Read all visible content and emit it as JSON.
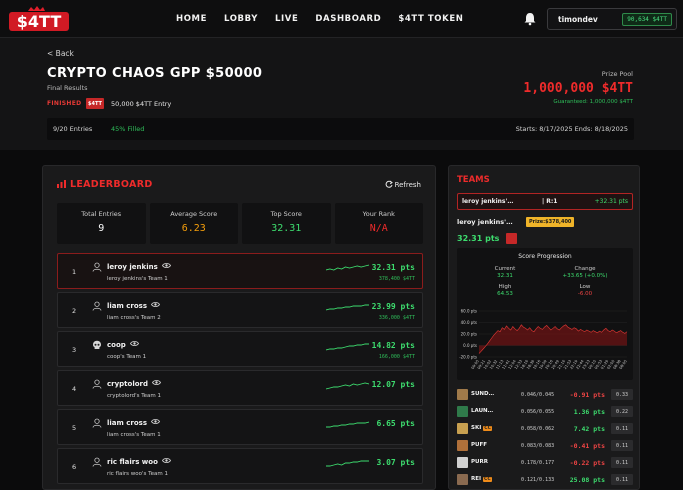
{
  "nav": {
    "logo_text": "$4TT",
    "links": [
      "HOME",
      "LOBBY",
      "LIVE",
      "DASHBOARD",
      "$4TT TOKEN"
    ],
    "username": "timondev",
    "balance": "90,634 $4TT"
  },
  "contest": {
    "back_label": "< Back",
    "title": "CRYPTO CHAOS GPP $50000",
    "subtitle": "Final Results",
    "status": "FINISHED",
    "token_tag": "$4TT",
    "entry_fee": "50,000 $4TT Entry",
    "prize_label": "Prize Pool",
    "prize_value": "1,000,000 $4TT",
    "guaranteed": "Guaranteed: 1,000,000 $4TT",
    "entries": "9/20 Entries",
    "filled": "45% Filled",
    "dates": "Starts: 8/17/2025   Ends: 8/18/2025"
  },
  "leaderboard": {
    "title": "LEADERBOARD",
    "refresh_label": "Refresh",
    "stats": [
      {
        "label": "Total Entries",
        "value": "9",
        "color": "#ffffff"
      },
      {
        "label": "Average Score",
        "value": "6.23",
        "color": "#f59e0b"
      },
      {
        "label": "Top Score",
        "value": "32.31",
        "color": "#3ddc6e"
      },
      {
        "label": "Your Rank",
        "value": "N/A",
        "color": "#ef2b2b"
      }
    ],
    "rows": [
      {
        "rank": "1",
        "name": "leroy jenkins",
        "team": "leroy jenkins's Team 1",
        "pts": "32.31 pts",
        "winnings": "378,400 $4TT",
        "avatar": "user"
      },
      {
        "rank": "2",
        "name": "liam cross",
        "team": "liam cross's Team 2",
        "pts": "23.99 pts",
        "winnings": "336,000 $4TT",
        "avatar": "user"
      },
      {
        "rank": "3",
        "name": "coop",
        "team": "coop's Team 1",
        "pts": "14.82 pts",
        "winnings": "166,000 $4TT",
        "avatar": "skull"
      },
      {
        "rank": "4",
        "name": "cryptolord",
        "team": "cryptolord's Team 1",
        "pts": "12.07 pts",
        "winnings": "",
        "avatar": "user"
      },
      {
        "rank": "5",
        "name": "liam cross",
        "team": "liam cross's Team 1",
        "pts": "6.65 pts",
        "winnings": "",
        "avatar": "user"
      },
      {
        "rank": "6",
        "name": "ric flairs woo",
        "team": "ric flairs woo's Team 1",
        "pts": "3.07 pts",
        "winnings": "",
        "avatar": "user"
      }
    ]
  },
  "teams": {
    "title": "TEAMS",
    "selected_name": "leroy jenkins'…",
    "selected_rank": "| R:1",
    "selected_pts": "+32.31 pts",
    "detail_name": "leroy jenkins'…",
    "prize_tag": "Prize:$378,400",
    "detail_pts": "32.31 pts",
    "progression": {
      "title": "Score Progression",
      "current_label": "Current",
      "current_value": "32.31",
      "change_label": "Change",
      "change_value": "+33.65 (+0.0%)",
      "high_label": "High",
      "high_value": "64.53",
      "low_label": "Low",
      "low_value": "-6.00"
    },
    "players": [
      {
        "name": "SUND…",
        "ratio": "0.046/0.045",
        "pts": "-0.91 pts",
        "own": "0.33",
        "color": "#ef4444",
        "pic": "#a07a4a",
        "cc": ""
      },
      {
        "name": "LAUN…",
        "ratio": "0.056/0.055",
        "pts": "1.36 pts",
        "own": "0.22",
        "color": "#3ddc6e",
        "pic": "#2f7a4a",
        "cc": ""
      },
      {
        "name": "SKI",
        "ratio": "0.058/0.062",
        "pts": "7.42 pts",
        "own": "0.11",
        "color": "#3ddc6e",
        "pic": "#c8a050",
        "cc": "CC"
      },
      {
        "name": "PUFF",
        "ratio": "0.083/0.083",
        "pts": "-0.41 pts",
        "own": "0.11",
        "color": "#ef4444",
        "pic": "#b0703a",
        "cc": ""
      },
      {
        "name": "PURR",
        "ratio": "0.178/0.177",
        "pts": "-0.22 pts",
        "own": "0.11",
        "color": "#ef4444",
        "pic": "#d0d0d0",
        "cc": ""
      },
      {
        "name": "REI",
        "ratio": "0.121/0.133",
        "pts": "25.08 pts",
        "own": "0.11",
        "color": "#3ddc6e",
        "pic": "#8a6a50",
        "cc": "CC"
      }
    ]
  },
  "chart_data": {
    "type": "area",
    "x": [
      "09:05",
      "09:21",
      "10:02",
      "10:32",
      "11:13",
      "11:41",
      "12:04",
      "12:33",
      "18:16",
      "18:39",
      "19:16",
      "19:59",
      "20:16",
      "20:49",
      "21:16",
      "21:53",
      "22:19",
      "22:44",
      "23:23",
      "00:10",
      "00:53",
      "01:29",
      "02:05",
      "08:38",
      "08:05"
    ],
    "yticks": [
      "60.0 pts",
      "40.0 pts",
      "20.0 pts",
      "0.0 pts",
      "-20.0 pts"
    ],
    "ylim": [
      -20,
      60
    ],
    "y": [
      -14,
      -10,
      -6,
      -2,
      3,
      8,
      13,
      18,
      22,
      26,
      24,
      31,
      28,
      34,
      30,
      27,
      33,
      29,
      26,
      30,
      36,
      32,
      30,
      27,
      31,
      26,
      24,
      29,
      33,
      30,
      28,
      32,
      35,
      31,
      27,
      30,
      33,
      29,
      27,
      31,
      34,
      36,
      32,
      30,
      28,
      31,
      29,
      25,
      28,
      26,
      24,
      27,
      25,
      23,
      26,
      24,
      22,
      25,
      23,
      27,
      30,
      26,
      24,
      27,
      25,
      22,
      24,
      26,
      23,
      21,
      24
    ]
  }
}
